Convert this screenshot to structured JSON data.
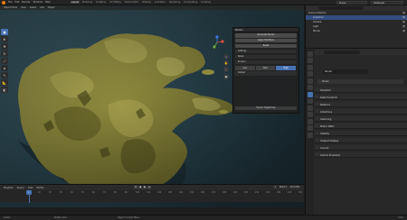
{
  "topbar": {
    "menu": [
      "File",
      "Edit",
      "Render",
      "Window",
      "Help"
    ],
    "workspaces": [
      "Layout",
      "Modeling",
      "Sculpting",
      "UV Editing",
      "Texture Paint",
      "Shading",
      "Animation",
      "Rendering",
      "Compositing",
      "Scripting"
    ],
    "active_workspace": "Layout",
    "scene": "Scene",
    "view_layer": "ViewLayer"
  },
  "viewport": {
    "header_items": [
      "Object Mode",
      "View",
      "Select",
      "Add",
      "Object"
    ],
    "tools": [
      "select-icon",
      "cursor-icon",
      "move-icon",
      "rotate-icon",
      "scale-icon",
      "transform-icon",
      "annotate-icon",
      "measure-icon",
      "add-cube-icon"
    ],
    "nav_buttons": [
      "+",
      "✋",
      "🎥",
      "▦"
    ]
  },
  "panel": {
    "title": "Terrain",
    "buttons": [
      "Generate Terrain",
      "Apply Modifiers",
      "Reset"
    ],
    "sections": [
      "Settings",
      "Noise",
      "Erosion"
    ],
    "segments": [
      "Low",
      "Med",
      "High"
    ],
    "selected_segment": "High",
    "section_bottom": "Output",
    "footer": "Export Heightmap"
  },
  "timeline": {
    "menus": [
      "Playback",
      "Keying",
      "View",
      "Marker"
    ],
    "playback_buttons": [
      "⏮",
      "◀",
      "▶",
      "⏭"
    ],
    "right": [
      "1",
      "Start 1",
      "End 250"
    ],
    "ruler": [
      "0",
      "10",
      "20",
      "30",
      "40",
      "50",
      "60",
      "70",
      "80",
      "90",
      "100",
      "110",
      "120",
      "130",
      "140",
      "150",
      "160",
      "170",
      "180",
      "190",
      "200",
      "210",
      "220",
      "230",
      "240",
      "250"
    ],
    "current_frame": "1"
  },
  "status": {
    "left": "Select",
    "middle": "Rotate View",
    "right": "Object Context Menu",
    "version": "3.0.0"
  },
  "outliner": {
    "rows": [
      {
        "label": "Scene Collection",
        "selected": false
      },
      {
        "label": "Collection",
        "selected": true
      },
      {
        "label": "Camera",
        "selected": false
      },
      {
        "label": "Light",
        "selected": false
      },
      {
        "label": "Terrain",
        "selected": false
      }
    ]
  },
  "properties": {
    "object_name": "Terrain",
    "field": "Terrain",
    "sections": [
      "Transform",
      "Delta Transform",
      "Relations",
      "Collections",
      "Instancing",
      "Motion Paths",
      "Visibility",
      "Viewport Display",
      "Line Art",
      "Custom Properties"
    ]
  },
  "colors": {
    "accent": "#4772b3",
    "terrain": "#8e8a3e",
    "water": "#2a4550"
  }
}
